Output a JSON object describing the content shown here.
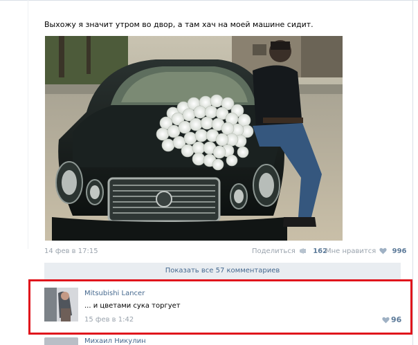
{
  "post": {
    "text": "Выхожу я значит утром во двор, а там хач на моей машине сидит.",
    "date": "14 фев в 17:15",
    "share_label": "Поделиться",
    "share_count": "162",
    "like_label": "Мне нравится",
    "like_count": "996"
  },
  "comments": {
    "show_all_label": "Показать все 57 комментариев",
    "items": [
      {
        "author": "Mitsubishi Lancer",
        "text": "... и цветами сука торгует",
        "date": "15 фев в 1:42",
        "likes": "96"
      },
      {
        "author": "Михаил Никулин"
      }
    ]
  },
  "colors": {
    "link": "#45688e",
    "muted": "#9aa3ad",
    "highlight_border": "#e0141c",
    "bar_bg": "#e9edf1"
  },
  "icons": {
    "share": "megaphone-icon",
    "like": "heart-icon",
    "comment_like": "heart-icon"
  }
}
